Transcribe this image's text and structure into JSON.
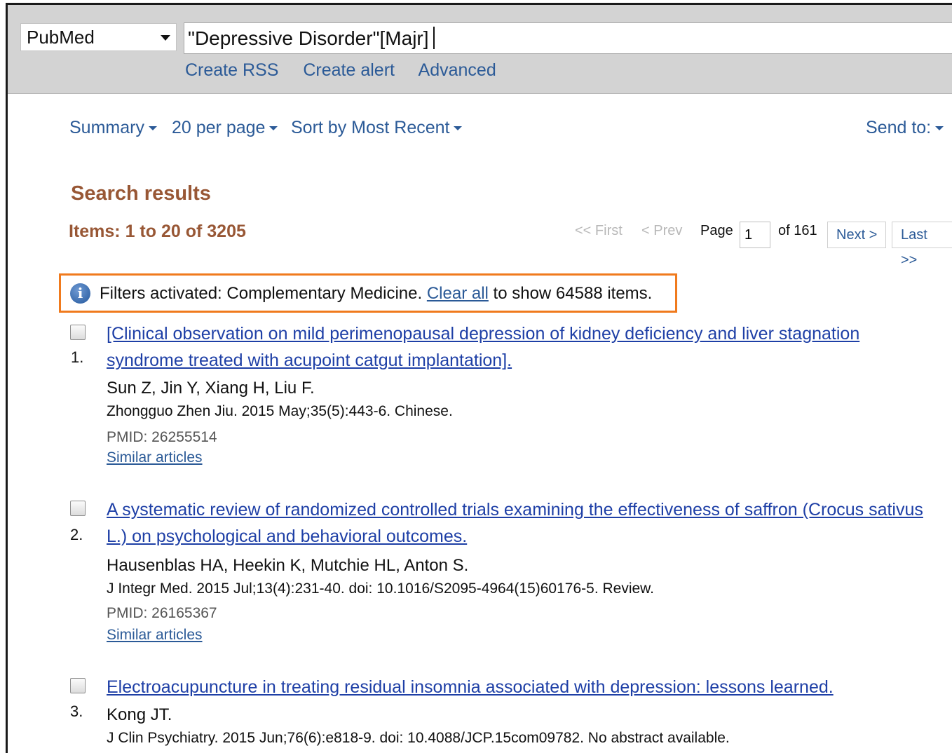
{
  "search": {
    "database": "PubMed",
    "query": "\"Depressive Disorder\"[Majr]",
    "links": [
      "Create RSS",
      "Create alert",
      "Advanced"
    ]
  },
  "toolbar": {
    "format": "Summary",
    "per_page": "20 per page",
    "sort": "Sort by Most Recent",
    "send_to": "Send to:"
  },
  "results": {
    "heading": "Search results",
    "items": "Items: 1 to 20 of 3205"
  },
  "pager": {
    "first": "<< First",
    "prev": "< Prev",
    "page_label": "Page",
    "page_value": "1",
    "of": "of 161",
    "next": "Next >",
    "last": "Last >>"
  },
  "filter": {
    "text_before": "Filters activated: Complementary Medicine. ",
    "clear_all": "Clear all",
    "text_after": " to show 64588 items."
  },
  "articles": [
    {
      "number": "1.",
      "title": "[Clinical observation on mild perimenopausal depression of kidney deficiency and liver stagnation syndrome treated with acupoint catgut implantation].",
      "authors": "Sun Z, Jin Y, Xiang H, Liu F.",
      "journal": "Zhongguo Zhen Jiu. 2015 May;35(5):443-6. Chinese.",
      "pmid": "PMID: 26255514",
      "similar": "Similar articles"
    },
    {
      "number": "2.",
      "title": "A systematic review of randomized controlled trials examining the effectiveness of saffron (Crocus sativus L.) on psychological and behavioral outcomes.",
      "authors": "Hausenblas HA, Heekin K, Mutchie HL, Anton S.",
      "journal": "J Integr Med. 2015 Jul;13(4):231-40. doi: 10.1016/S2095-4964(15)60176-5. Review.",
      "pmid": "PMID: 26165367",
      "similar": "Similar articles"
    },
    {
      "number": "3.",
      "title": "Electroacupuncture in treating residual insomnia associated with depression: lessons learned.",
      "authors": "Kong JT.",
      "journal": "J Clin Psychiatry. 2015 Jun;76(6):e818-9. doi: 10.4088/JCP.15com09782. No abstract available."
    }
  ]
}
